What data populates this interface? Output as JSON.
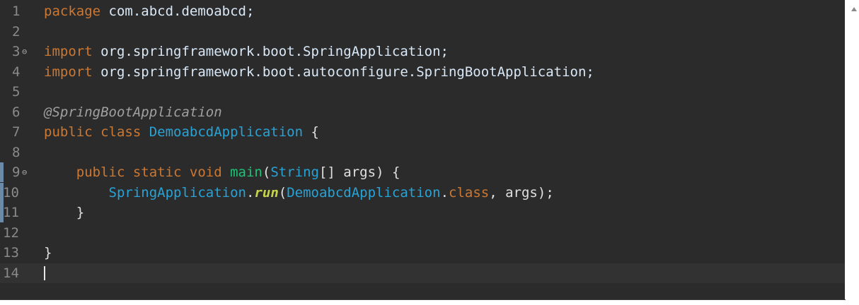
{
  "editor": {
    "lines": [
      {
        "num": "1",
        "tokens": [
          {
            "t": "package",
            "c": "kw"
          },
          {
            "t": " com.abcd.demoabcd;",
            "c": "ident"
          }
        ]
      },
      {
        "num": "2",
        "tokens": []
      },
      {
        "num": "3",
        "fold": "⊖",
        "tokens": [
          {
            "t": "import",
            "c": "kw"
          },
          {
            "t": " org.springframework.boot.SpringApplication;",
            "c": "ident"
          }
        ]
      },
      {
        "num": "4",
        "tokens": [
          {
            "t": "import",
            "c": "kw"
          },
          {
            "t": " org.springframework.boot.autoconfigure.SpringBootApplication;",
            "c": "ident"
          }
        ]
      },
      {
        "num": "5",
        "tokens": []
      },
      {
        "num": "6",
        "tokens": [
          {
            "t": "@SpringBootApplication",
            "c": "ann"
          }
        ]
      },
      {
        "num": "7",
        "tokens": [
          {
            "t": "public class ",
            "c": "kw"
          },
          {
            "t": "DemoabcdApplication",
            "c": "type"
          },
          {
            "t": " {",
            "c": "punct"
          }
        ]
      },
      {
        "num": "8",
        "tokens": []
      },
      {
        "num": "9",
        "fold": "⊖",
        "change": true,
        "tokens": [
          {
            "t": "    public static void ",
            "c": "kw"
          },
          {
            "t": "main",
            "c": "meth"
          },
          {
            "t": "(",
            "c": "punct"
          },
          {
            "t": "String",
            "c": "type"
          },
          {
            "t": "[] ",
            "c": "punct"
          },
          {
            "t": "args",
            "c": "var"
          },
          {
            "t": ") {",
            "c": "punct"
          }
        ]
      },
      {
        "num": "10",
        "change": true,
        "tokens": [
          {
            "t": "        SpringApplication",
            "c": "type"
          },
          {
            "t": ".",
            "c": "punct"
          },
          {
            "t": "run",
            "c": "static-m"
          },
          {
            "t": "(",
            "c": "punct"
          },
          {
            "t": "DemoabcdApplication",
            "c": "type"
          },
          {
            "t": ".",
            "c": "punct"
          },
          {
            "t": "class",
            "c": "kw"
          },
          {
            "t": ", ",
            "c": "punct"
          },
          {
            "t": "args",
            "c": "var"
          },
          {
            "t": ");",
            "c": "punct"
          }
        ]
      },
      {
        "num": "11",
        "change": true,
        "tokens": [
          {
            "t": "    }",
            "c": "punct"
          }
        ]
      },
      {
        "num": "12",
        "tokens": []
      },
      {
        "num": "13",
        "tokens": [
          {
            "t": "}",
            "c": "punct"
          }
        ]
      },
      {
        "num": "14",
        "current": true,
        "tokens": []
      }
    ]
  },
  "colors": {
    "background": "#2b2b2b",
    "keyword": "#cc7832",
    "type": "#28a3d6",
    "method": "#1ec276",
    "static_method": "#c6d34a",
    "line_number": "#8a8a8a"
  }
}
